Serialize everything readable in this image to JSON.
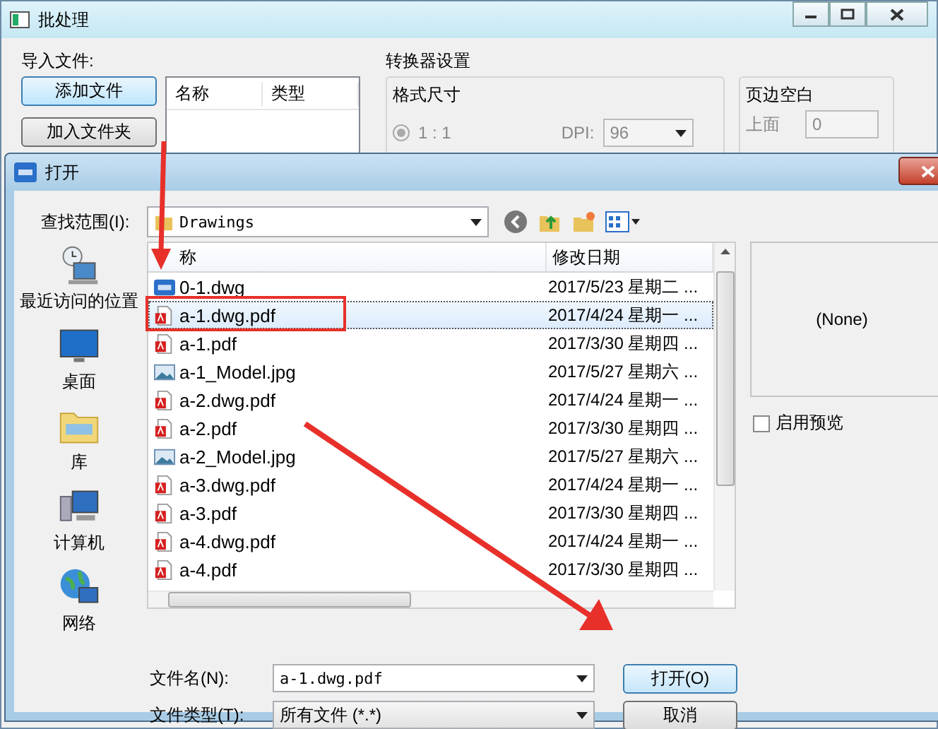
{
  "main_window": {
    "title": "批处理",
    "import_group": {
      "label": "导入文件:",
      "buttons": [
        {
          "label": "添加文件",
          "focused": true
        },
        {
          "label": "加入文件夹",
          "focused": false
        }
      ],
      "list_columns": [
        "名称",
        "类型"
      ]
    },
    "converter": {
      "title": "转换器设置",
      "format_group": {
        "title": "格式尺寸",
        "radio": {
          "label": "1 : 1",
          "selected": true
        },
        "dpi_label": "DPI:",
        "dpi_value": "96"
      },
      "margin_group": {
        "title": "页边空白",
        "top_label": "上面",
        "top_value": "0"
      }
    }
  },
  "dialog": {
    "title": "打开",
    "look_in_label": "查找范围(I):",
    "location": "Drawings",
    "places": [
      {
        "kind": "recent",
        "label": "最近访问的位置"
      },
      {
        "kind": "desktop",
        "label": "桌面"
      },
      {
        "kind": "library",
        "label": "库"
      },
      {
        "kind": "computer",
        "label": "计算机"
      },
      {
        "kind": "network",
        "label": "网络"
      }
    ],
    "columns": [
      "称",
      "修改日期"
    ],
    "files": [
      {
        "name": "0-1.dwg",
        "kind": "cad",
        "date": "2017/5/23 星期二 ...",
        "selected": false
      },
      {
        "name": "a-1.dwg.pdf",
        "kind": "pdf",
        "date": "2017/4/24 星期一 ...",
        "selected": true
      },
      {
        "name": "a-1.pdf",
        "kind": "pdf",
        "date": "2017/3/30 星期四 ...",
        "selected": false
      },
      {
        "name": "a-1_Model.jpg",
        "kind": "image",
        "date": "2017/5/27 星期六 ...",
        "selected": false
      },
      {
        "name": "a-2.dwg.pdf",
        "kind": "pdf",
        "date": "2017/4/24 星期一 ...",
        "selected": false
      },
      {
        "name": "a-2.pdf",
        "kind": "pdf",
        "date": "2017/3/30 星期四 ...",
        "selected": false
      },
      {
        "name": "a-2_Model.jpg",
        "kind": "image",
        "date": "2017/5/27 星期六 ...",
        "selected": false
      },
      {
        "name": "a-3.dwg.pdf",
        "kind": "pdf",
        "date": "2017/4/24 星期一 ...",
        "selected": false
      },
      {
        "name": "a-3.pdf",
        "kind": "pdf",
        "date": "2017/3/30 星期四 ...",
        "selected": false
      },
      {
        "name": "a-4.dwg.pdf",
        "kind": "pdf",
        "date": "2017/4/24 星期一 ...",
        "selected": false
      },
      {
        "name": "a-4.pdf",
        "kind": "pdf",
        "date": "2017/3/30 星期四 ...",
        "selected": false
      }
    ],
    "preview": {
      "text": "(None)"
    },
    "enable_preview": {
      "label": "启用预览",
      "checked": false
    },
    "filename": {
      "label": "文件名(N):",
      "value": "a-1.dwg.pdf"
    },
    "filetype": {
      "label": "文件类型(T):",
      "value": "所有文件 (*.*)"
    },
    "buttons": [
      {
        "label": "打开(O)",
        "focused": true
      },
      {
        "label": "取消",
        "focused": false
      }
    ]
  }
}
